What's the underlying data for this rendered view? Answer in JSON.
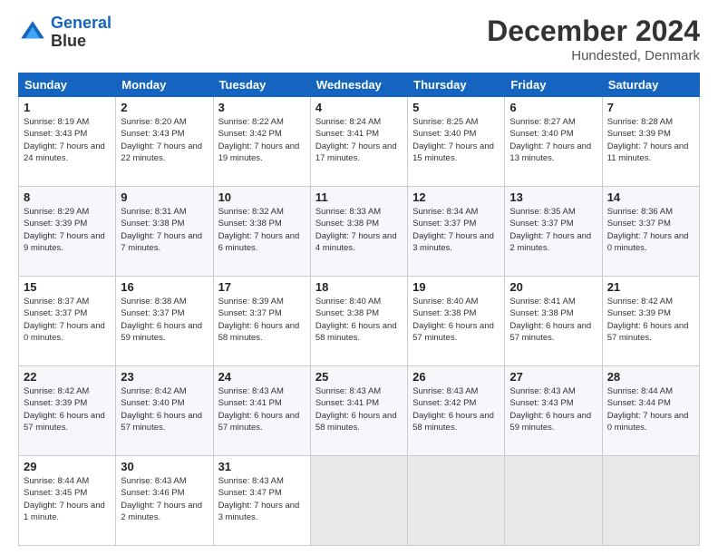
{
  "header": {
    "logo_line1": "General",
    "logo_line2": "Blue",
    "month_title": "December 2024",
    "subtitle": "Hundested, Denmark"
  },
  "days_of_week": [
    "Sunday",
    "Monday",
    "Tuesday",
    "Wednesday",
    "Thursday",
    "Friday",
    "Saturday"
  ],
  "weeks": [
    [
      {
        "day": "1",
        "sunrise": "Sunrise: 8:19 AM",
        "sunset": "Sunset: 3:43 PM",
        "daylight": "Daylight: 7 hours and 24 minutes."
      },
      {
        "day": "2",
        "sunrise": "Sunrise: 8:20 AM",
        "sunset": "Sunset: 3:43 PM",
        "daylight": "Daylight: 7 hours and 22 minutes."
      },
      {
        "day": "3",
        "sunrise": "Sunrise: 8:22 AM",
        "sunset": "Sunset: 3:42 PM",
        "daylight": "Daylight: 7 hours and 19 minutes."
      },
      {
        "day": "4",
        "sunrise": "Sunrise: 8:24 AM",
        "sunset": "Sunset: 3:41 PM",
        "daylight": "Daylight: 7 hours and 17 minutes."
      },
      {
        "day": "5",
        "sunrise": "Sunrise: 8:25 AM",
        "sunset": "Sunset: 3:40 PM",
        "daylight": "Daylight: 7 hours and 15 minutes."
      },
      {
        "day": "6",
        "sunrise": "Sunrise: 8:27 AM",
        "sunset": "Sunset: 3:40 PM",
        "daylight": "Daylight: 7 hours and 13 minutes."
      },
      {
        "day": "7",
        "sunrise": "Sunrise: 8:28 AM",
        "sunset": "Sunset: 3:39 PM",
        "daylight": "Daylight: 7 hours and 11 minutes."
      }
    ],
    [
      {
        "day": "8",
        "sunrise": "Sunrise: 8:29 AM",
        "sunset": "Sunset: 3:39 PM",
        "daylight": "Daylight: 7 hours and 9 minutes."
      },
      {
        "day": "9",
        "sunrise": "Sunrise: 8:31 AM",
        "sunset": "Sunset: 3:38 PM",
        "daylight": "Daylight: 7 hours and 7 minutes."
      },
      {
        "day": "10",
        "sunrise": "Sunrise: 8:32 AM",
        "sunset": "Sunset: 3:38 PM",
        "daylight": "Daylight: 7 hours and 6 minutes."
      },
      {
        "day": "11",
        "sunrise": "Sunrise: 8:33 AM",
        "sunset": "Sunset: 3:38 PM",
        "daylight": "Daylight: 7 hours and 4 minutes."
      },
      {
        "day": "12",
        "sunrise": "Sunrise: 8:34 AM",
        "sunset": "Sunset: 3:37 PM",
        "daylight": "Daylight: 7 hours and 3 minutes."
      },
      {
        "day": "13",
        "sunrise": "Sunrise: 8:35 AM",
        "sunset": "Sunset: 3:37 PM",
        "daylight": "Daylight: 7 hours and 2 minutes."
      },
      {
        "day": "14",
        "sunrise": "Sunrise: 8:36 AM",
        "sunset": "Sunset: 3:37 PM",
        "daylight": "Daylight: 7 hours and 0 minutes."
      }
    ],
    [
      {
        "day": "15",
        "sunrise": "Sunrise: 8:37 AM",
        "sunset": "Sunset: 3:37 PM",
        "daylight": "Daylight: 7 hours and 0 minutes."
      },
      {
        "day": "16",
        "sunrise": "Sunrise: 8:38 AM",
        "sunset": "Sunset: 3:37 PM",
        "daylight": "Daylight: 6 hours and 59 minutes."
      },
      {
        "day": "17",
        "sunrise": "Sunrise: 8:39 AM",
        "sunset": "Sunset: 3:37 PM",
        "daylight": "Daylight: 6 hours and 58 minutes."
      },
      {
        "day": "18",
        "sunrise": "Sunrise: 8:40 AM",
        "sunset": "Sunset: 3:38 PM",
        "daylight": "Daylight: 6 hours and 58 minutes."
      },
      {
        "day": "19",
        "sunrise": "Sunrise: 8:40 AM",
        "sunset": "Sunset: 3:38 PM",
        "daylight": "Daylight: 6 hours and 57 minutes."
      },
      {
        "day": "20",
        "sunrise": "Sunrise: 8:41 AM",
        "sunset": "Sunset: 3:38 PM",
        "daylight": "Daylight: 6 hours and 57 minutes."
      },
      {
        "day": "21",
        "sunrise": "Sunrise: 8:42 AM",
        "sunset": "Sunset: 3:39 PM",
        "daylight": "Daylight: 6 hours and 57 minutes."
      }
    ],
    [
      {
        "day": "22",
        "sunrise": "Sunrise: 8:42 AM",
        "sunset": "Sunset: 3:39 PM",
        "daylight": "Daylight: 6 hours and 57 minutes."
      },
      {
        "day": "23",
        "sunrise": "Sunrise: 8:42 AM",
        "sunset": "Sunset: 3:40 PM",
        "daylight": "Daylight: 6 hours and 57 minutes."
      },
      {
        "day": "24",
        "sunrise": "Sunrise: 8:43 AM",
        "sunset": "Sunset: 3:41 PM",
        "daylight": "Daylight: 6 hours and 57 minutes."
      },
      {
        "day": "25",
        "sunrise": "Sunrise: 8:43 AM",
        "sunset": "Sunset: 3:41 PM",
        "daylight": "Daylight: 6 hours and 58 minutes."
      },
      {
        "day": "26",
        "sunrise": "Sunrise: 8:43 AM",
        "sunset": "Sunset: 3:42 PM",
        "daylight": "Daylight: 6 hours and 58 minutes."
      },
      {
        "day": "27",
        "sunrise": "Sunrise: 8:43 AM",
        "sunset": "Sunset: 3:43 PM",
        "daylight": "Daylight: 6 hours and 59 minutes."
      },
      {
        "day": "28",
        "sunrise": "Sunrise: 8:44 AM",
        "sunset": "Sunset: 3:44 PM",
        "daylight": "Daylight: 7 hours and 0 minutes."
      }
    ],
    [
      {
        "day": "29",
        "sunrise": "Sunrise: 8:44 AM",
        "sunset": "Sunset: 3:45 PM",
        "daylight": "Daylight: 7 hours and 1 minute."
      },
      {
        "day": "30",
        "sunrise": "Sunrise: 8:43 AM",
        "sunset": "Sunset: 3:46 PM",
        "daylight": "Daylight: 7 hours and 2 minutes."
      },
      {
        "day": "31",
        "sunrise": "Sunrise: 8:43 AM",
        "sunset": "Sunset: 3:47 PM",
        "daylight": "Daylight: 7 hours and 3 minutes."
      },
      null,
      null,
      null,
      null
    ]
  ]
}
